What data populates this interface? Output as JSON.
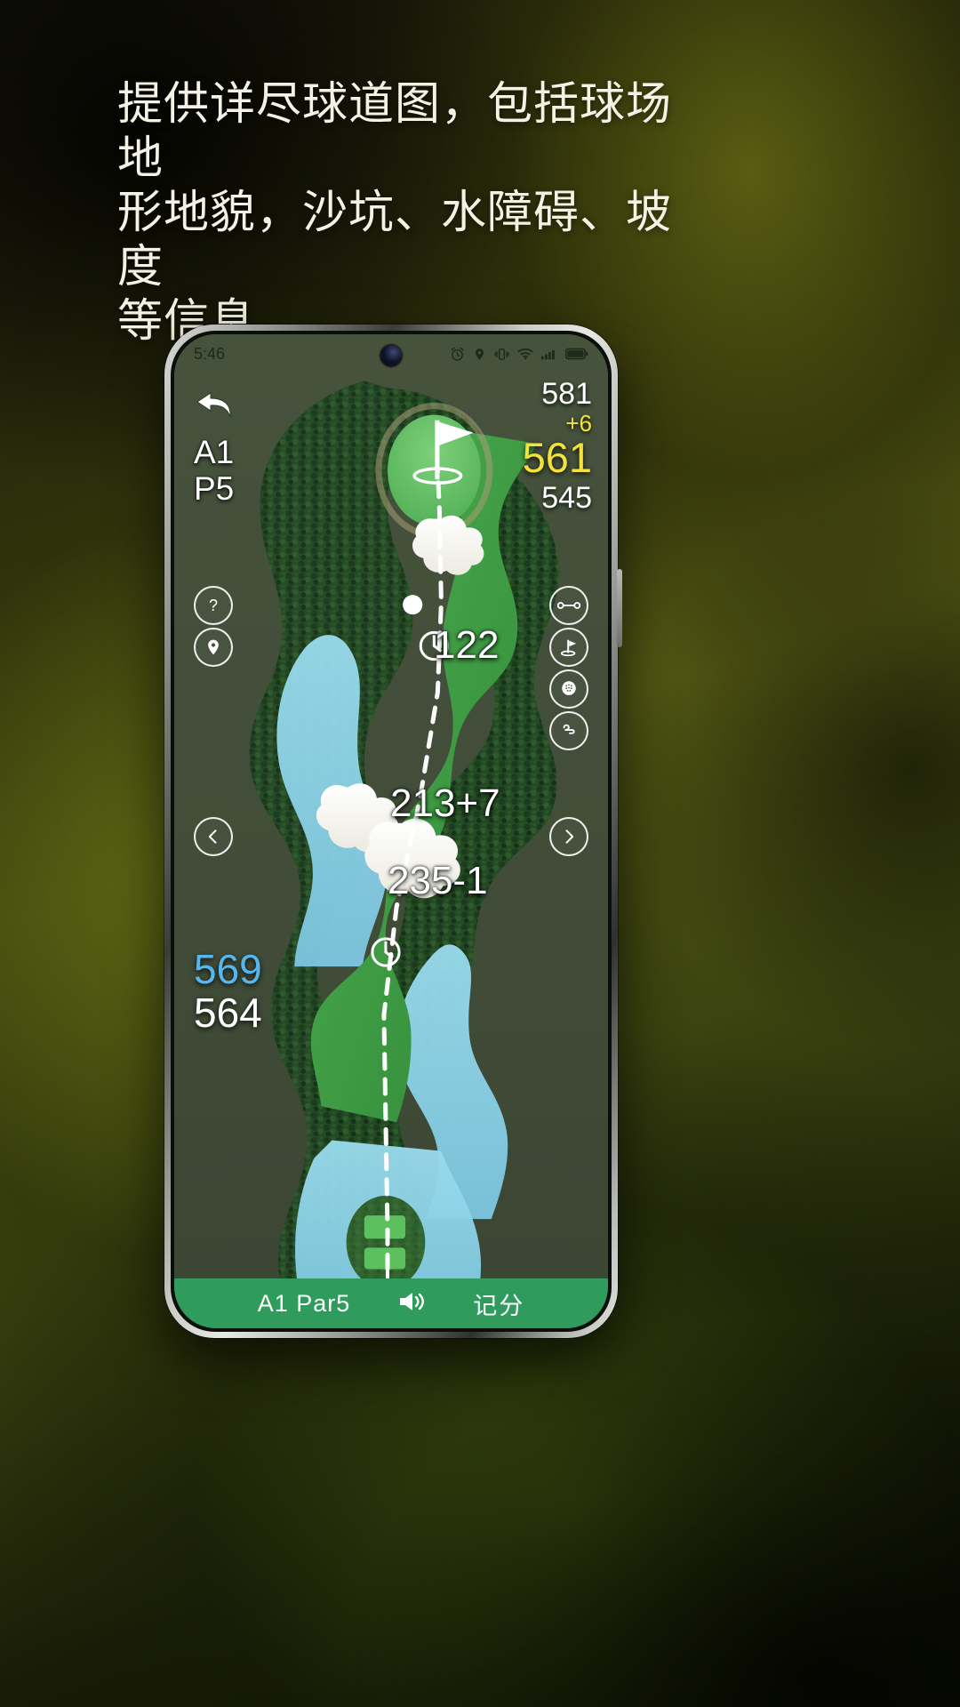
{
  "promo": {
    "headline": "提供详尽球道图，包括球场地\n形地貌，沙坑、水障碍、坡度\n等信息。"
  },
  "status_bar": {
    "time": "5:46",
    "icons": [
      "alarm-icon",
      "location-icon",
      "vibrate-icon",
      "wifi-icon",
      "signal-icon",
      "battery-icon"
    ]
  },
  "app": {
    "back_icon": "back-arrow-icon",
    "hole_label": "A1",
    "par_label": "P5",
    "distances": {
      "back": "581",
      "delta": "+6",
      "center": "561",
      "front": "545"
    },
    "map_labels": {
      "to_pin": "122",
      "carry": "213+7",
      "layup": "235-1"
    },
    "tee_distances": {
      "primary": "569",
      "secondary": "564"
    },
    "left_buttons": [
      {
        "name": "help-button",
        "icon": "question-mark-icon"
      },
      {
        "name": "location-button",
        "icon": "map-pin-icon"
      },
      {
        "name": "previous-hole-button",
        "icon": "chevron-left-icon"
      }
    ],
    "right_buttons": [
      {
        "name": "measure-button",
        "icon": "measure-line-icon"
      },
      {
        "name": "pin-position-button",
        "icon": "flag-icon"
      },
      {
        "name": "green-view-button",
        "icon": "golf-ball-icon"
      },
      {
        "name": "wind-button",
        "icon": "wind-icon"
      },
      {
        "name": "next-hole-button",
        "icon": "chevron-right-icon"
      }
    ],
    "bottom_bar": {
      "hole_par": "A1  Par5",
      "sound_icon": "speaker-icon",
      "scorecard_label": "记分"
    }
  },
  "colors": {
    "accent_yellow": "#f4e13c",
    "accent_cyan": "#56b7f0",
    "bar_green": "#2f9c5d",
    "fairway_green": "#3f9c44",
    "water_blue": "#8fd3e8",
    "sand": "#ffffff"
  }
}
